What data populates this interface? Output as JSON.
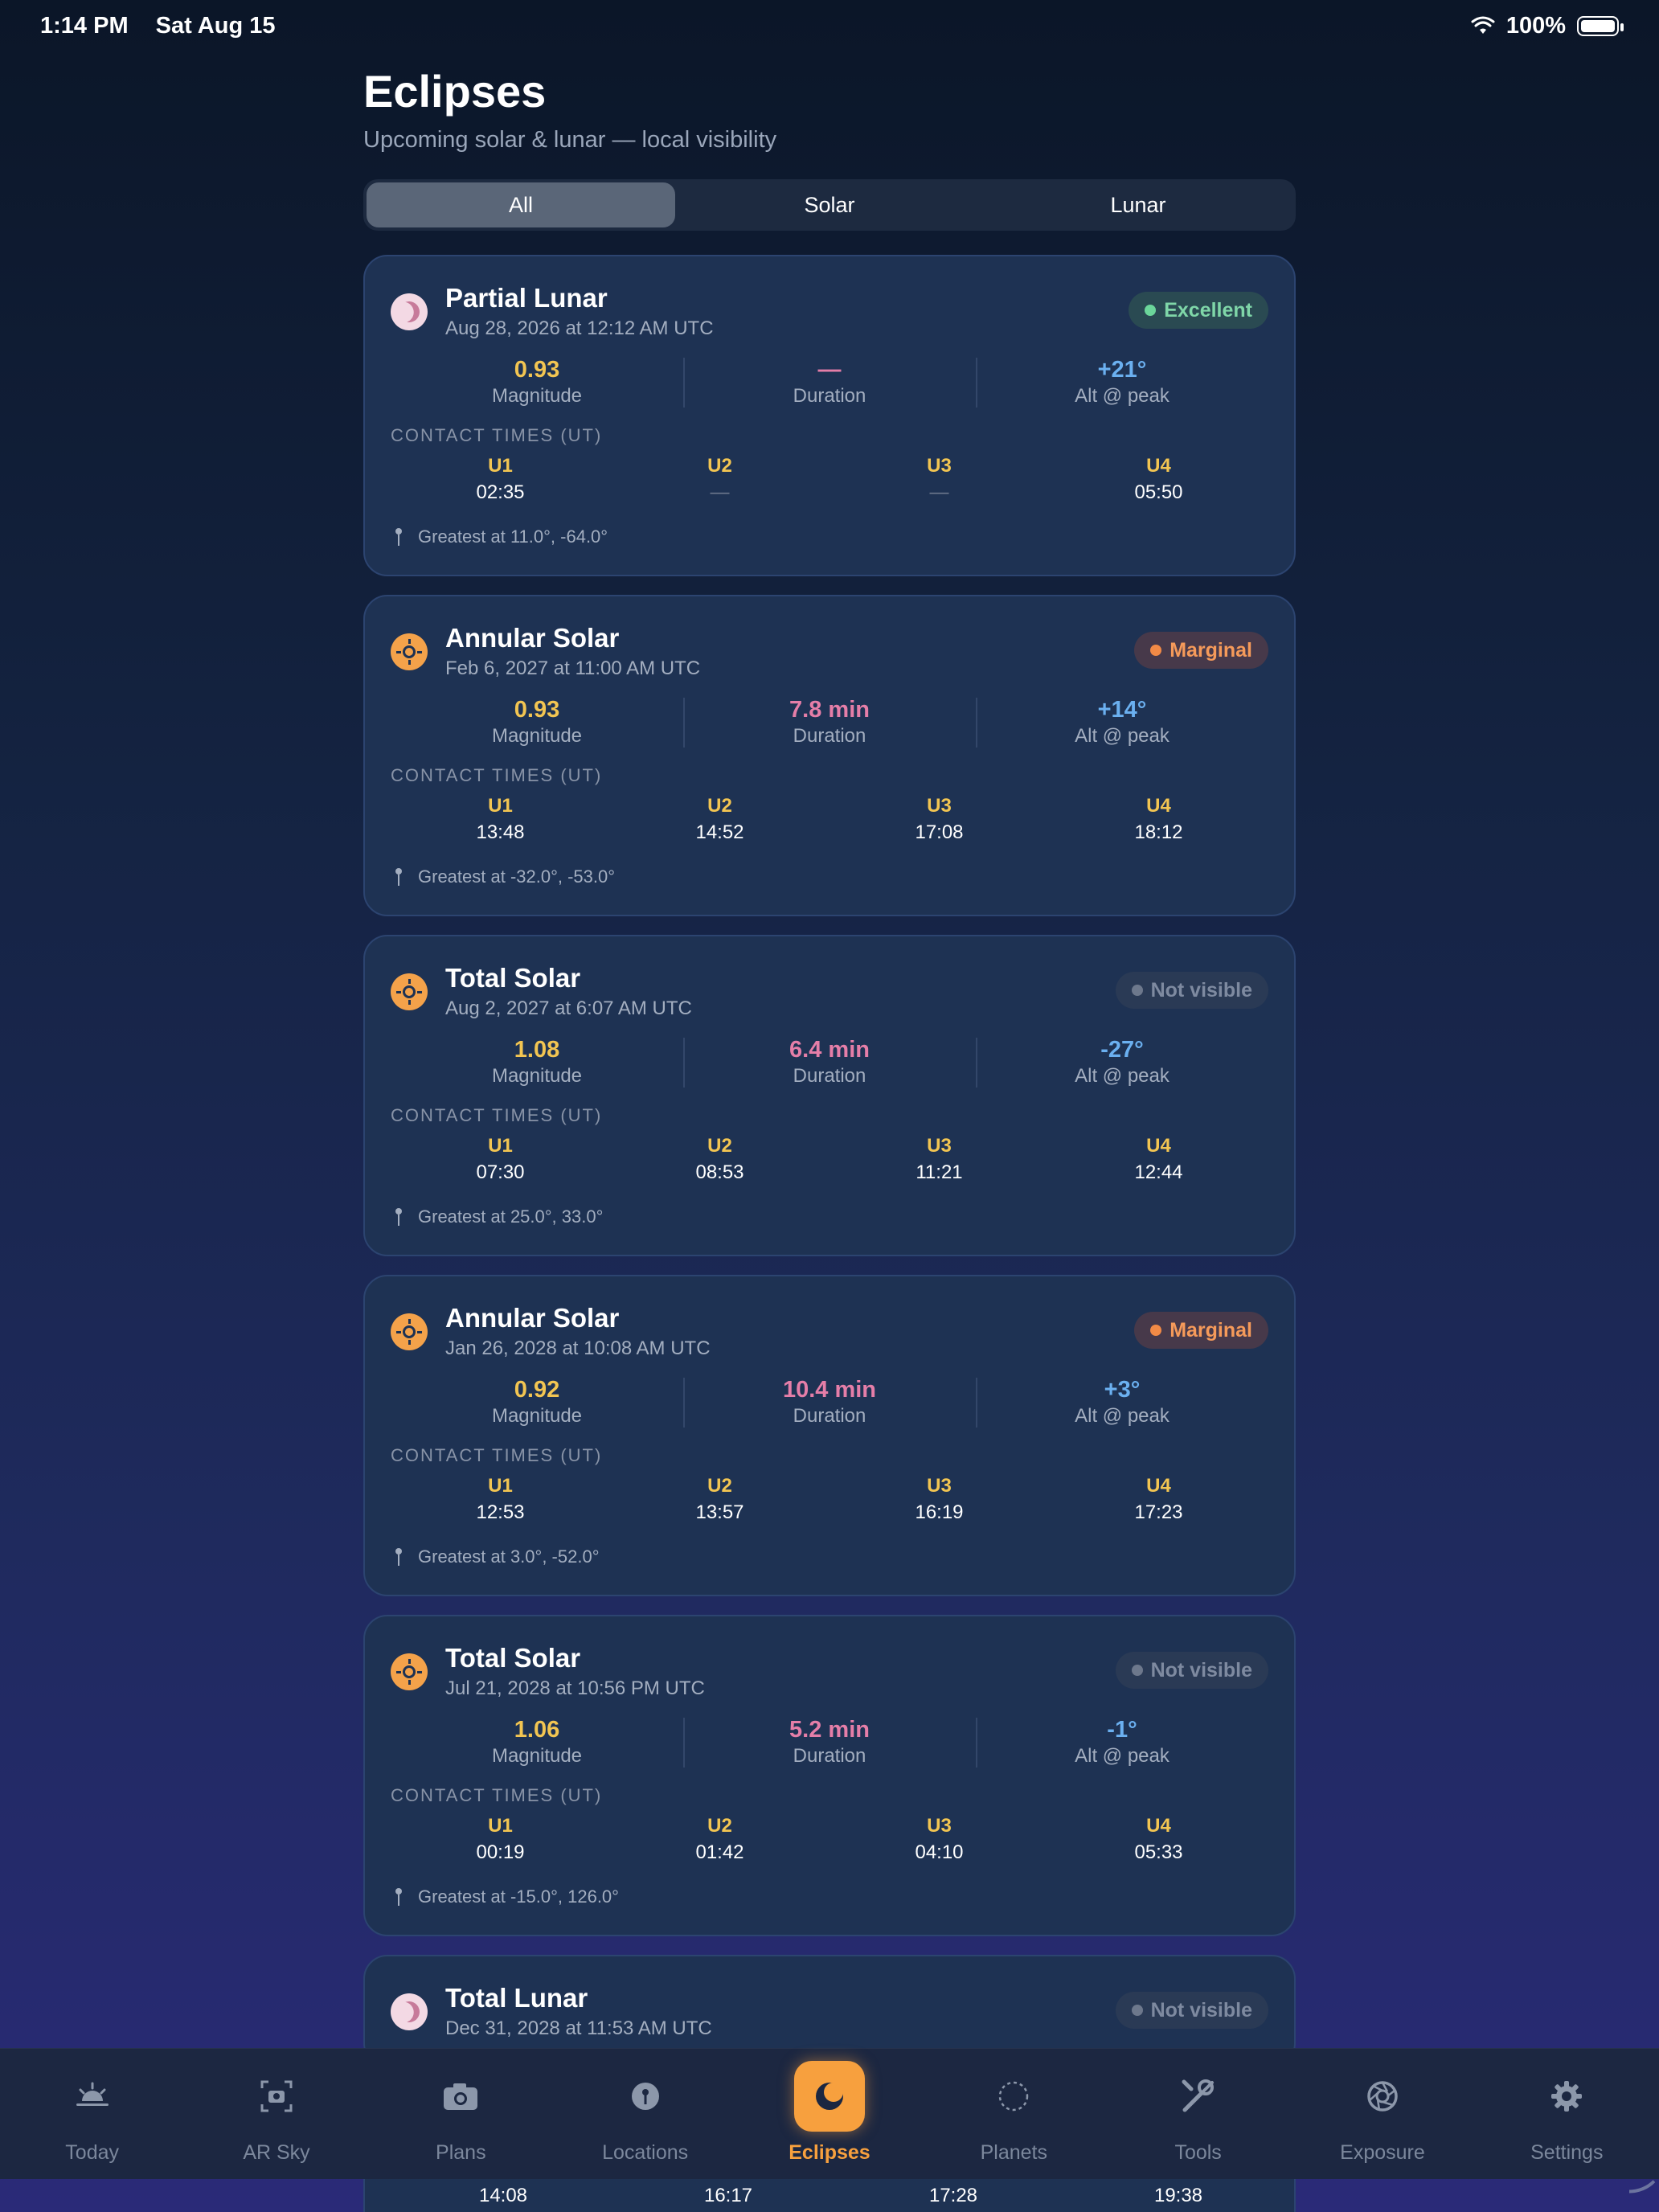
{
  "status_bar": {
    "time": "1:14 PM",
    "date": "Sat Aug 15",
    "battery": "100%"
  },
  "header": {
    "title": "Eclipses",
    "subtitle": "Upcoming solar & lunar — local visibility"
  },
  "filter": {
    "options": [
      "All",
      "Solar",
      "Lunar"
    ],
    "selected": "All"
  },
  "labels": {
    "magnitude": "Magnitude",
    "duration": "Duration",
    "alt": "Alt @ peak",
    "contact_times": "CONTACT TIMES (UT)",
    "u1": "U1",
    "u2": "U2",
    "u3": "U3",
    "u4": "U4"
  },
  "eclipses": [
    {
      "icon": "moon-icon",
      "title": "Partial Lunar",
      "date": "Aug 28, 2026 at 12:12 AM UTC",
      "visibility": "Excellent",
      "magnitude": "0.93",
      "duration": "—",
      "alt": "+21°",
      "u1": "02:35",
      "u2": "—",
      "u3": "—",
      "u4": "05:50",
      "greatest": "Greatest at 11.0°, -64.0°"
    },
    {
      "icon": "sun-icon",
      "title": "Annular Solar",
      "date": "Feb 6, 2027 at 11:00 AM UTC",
      "visibility": "Marginal",
      "magnitude": "0.93",
      "duration": "7.8 min",
      "alt": "+14°",
      "u1": "13:48",
      "u2": "14:52",
      "u3": "17:08",
      "u4": "18:12",
      "greatest": "Greatest at -32.0°, -53.0°"
    },
    {
      "icon": "sun-icon",
      "title": "Total Solar",
      "date": "Aug 2, 2027 at 6:07 AM UTC",
      "visibility": "Not visible",
      "magnitude": "1.08",
      "duration": "6.4 min",
      "alt": "-27°",
      "u1": "07:30",
      "u2": "08:53",
      "u3": "11:21",
      "u4": "12:44",
      "greatest": "Greatest at 25.0°, 33.0°"
    },
    {
      "icon": "sun-icon",
      "title": "Annular Solar",
      "date": "Jan 26, 2028 at 10:08 AM UTC",
      "visibility": "Marginal",
      "magnitude": "0.92",
      "duration": "10.4 min",
      "alt": "+3°",
      "u1": "12:53",
      "u2": "13:57",
      "u3": "16:19",
      "u4": "17:23",
      "greatest": "Greatest at 3.0°, -52.0°"
    },
    {
      "icon": "sun-icon",
      "title": "Total Solar",
      "date": "Jul 21, 2028 at 10:56 PM UTC",
      "visibility": "Not visible",
      "magnitude": "1.06",
      "duration": "5.2 min",
      "alt": "-1°",
      "u1": "00:19",
      "u2": "01:42",
      "u3": "04:10",
      "u4": "05:33",
      "greatest": "Greatest at -15.0°, 126.0°"
    },
    {
      "icon": "moon-icon",
      "title": "Total Lunar",
      "date": "Dec 31, 2028 at 11:53 AM UTC",
      "visibility": "Not visible",
      "u1": "14:08",
      "u2": "16:17",
      "u3": "17:28",
      "u4": "19:38"
    }
  ],
  "tab_bar": {
    "active": "Eclipses",
    "items": [
      {
        "label": "Today",
        "icon": "sunrise-icon"
      },
      {
        "label": "AR Sky",
        "icon": "ar-camera-icon"
      },
      {
        "label": "Plans",
        "icon": "camera-icon"
      },
      {
        "label": "Locations",
        "icon": "location-pin-icon"
      },
      {
        "label": "Eclipses",
        "icon": "eclipse-icon"
      },
      {
        "label": "Planets",
        "icon": "planet-orbit-icon"
      },
      {
        "label": "Tools",
        "icon": "tools-icon"
      },
      {
        "label": "Exposure",
        "icon": "aperture-icon"
      },
      {
        "label": "Settings",
        "icon": "gear-icon"
      }
    ]
  },
  "colors": {
    "magnitude": "#f2c552",
    "duration": "#e57ea8",
    "altitude": "#6bb0f0",
    "excellent": "#6bd69a",
    "marginal": "#f28a46",
    "accent": "#f7a03e"
  }
}
